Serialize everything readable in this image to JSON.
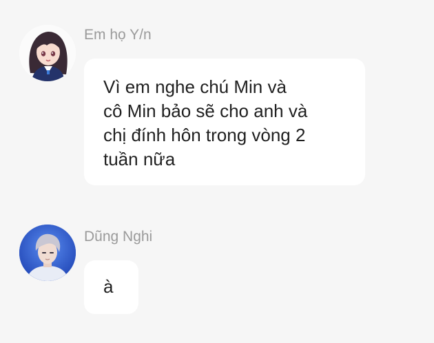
{
  "chat": {
    "messages": [
      {
        "sender": "Em họ Y/n",
        "avatar_icon": "anime-girl-avatar",
        "text": "Vì em nghe chú Min và\ncô Min bảo sẽ cho anh và\nchị đính hôn trong vòng 2\ntuần nữa"
      },
      {
        "sender": "Dũng Nghi",
        "avatar_icon": "young-man-photo-avatar",
        "text": "à"
      }
    ]
  },
  "colors": {
    "background": "#f6f6f6",
    "bubble": "#ffffff",
    "sender_name": "#9a9a9a",
    "message_text": "#1f1f1f"
  }
}
